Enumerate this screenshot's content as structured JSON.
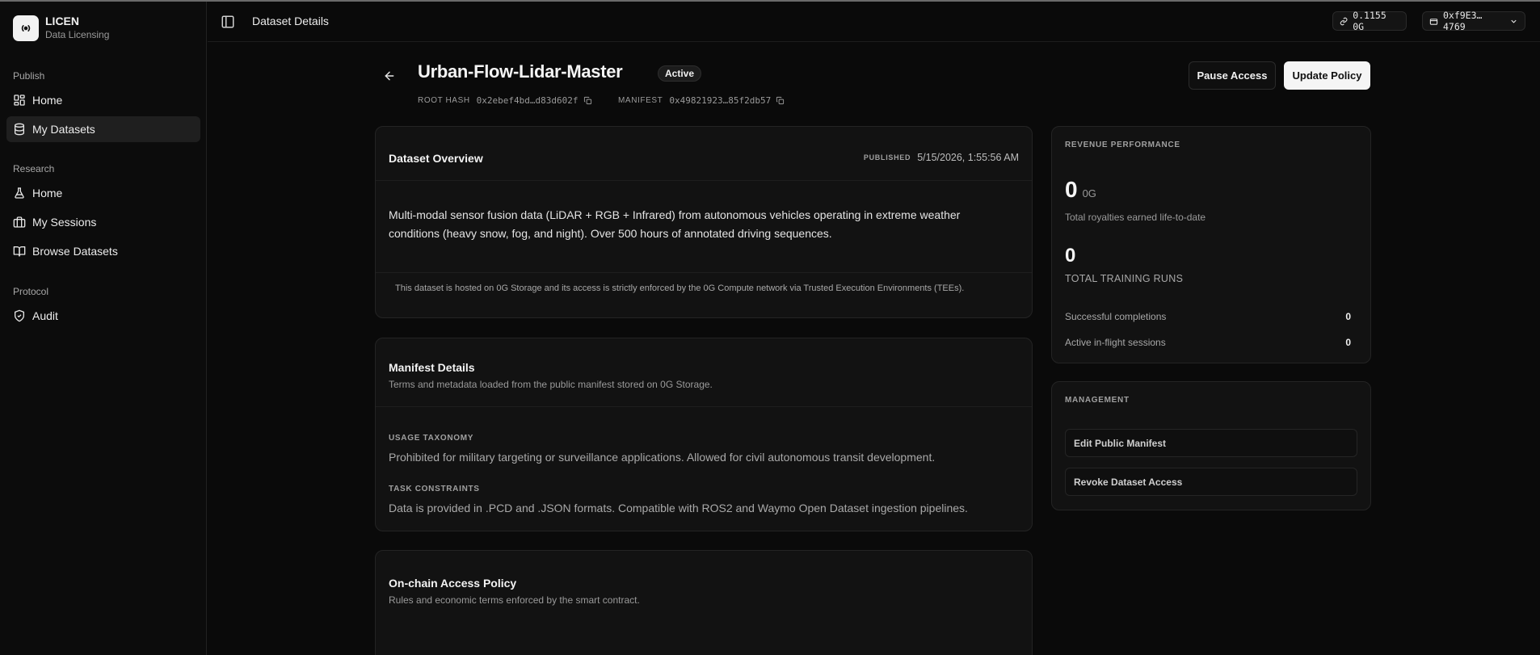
{
  "brand": {
    "name": "LICEN",
    "subtitle": "Data Licensing"
  },
  "sidebar": {
    "groups": [
      {
        "label": "Publish",
        "items": [
          {
            "label": "Home",
            "icon": "grid-icon"
          },
          {
            "label": "My Datasets",
            "icon": "database-icon",
            "active": true
          }
        ]
      },
      {
        "label": "Research",
        "items": [
          {
            "label": "Home",
            "icon": "flask-icon"
          },
          {
            "label": "My Sessions",
            "icon": "briefcase-icon"
          },
          {
            "label": "Browse Datasets",
            "icon": "book-open-icon"
          }
        ]
      },
      {
        "label": "Protocol",
        "items": [
          {
            "label": "Audit",
            "icon": "shield-check-icon"
          }
        ]
      }
    ]
  },
  "header": {
    "title": "Dataset Details",
    "balance": "0.1155 0G",
    "wallet": "0xf9E3…4769"
  },
  "dataset": {
    "name": "Urban-Flow-Lidar-Master",
    "status": "Active",
    "root_hash_label": "ROOT HASH",
    "root_hash": "0x2ebef4bd…d83d602f",
    "manifest_label": "MANIFEST",
    "manifest": "0x49821923…85f2db57"
  },
  "actions": {
    "pause": "Pause Access",
    "update": "Update Policy"
  },
  "overview": {
    "title": "Dataset Overview",
    "published_label": "PUBLISHED",
    "published_at": "5/15/2026, 1:55:56 AM",
    "description": "Multi-modal sensor fusion data (LiDAR + RGB + Infrared) from autonomous vehicles operating in extreme weather conditions (heavy snow, fog, and night). Over 500 hours of annotated driving sequences.",
    "footnote": "This dataset is hosted on 0G Storage and its access is strictly enforced by the 0G Compute network via Trusted Execution Environments (TEEs)."
  },
  "manifest_details": {
    "title": "Manifest Details",
    "subtitle": "Terms and metadata loaded from the public manifest stored on 0G Storage.",
    "usage_label": "USAGE TAXONOMY",
    "usage": "Prohibited for military targeting or surveillance applications. Allowed for civil autonomous transit development.",
    "constraints_label": "TASK CONSTRAINTS",
    "constraints": "Data is provided in .PCD and .JSON formats. Compatible with ROS2 and Waymo Open Dataset ingestion pipelines."
  },
  "policy": {
    "title": "On-chain Access Policy",
    "subtitle": "Rules and economic terms enforced by the smart contract."
  },
  "revenue": {
    "title": "REVENUE PERFORMANCE",
    "royalties_value": "0",
    "royalties_unit": "0G",
    "royalties_label": "Total royalties earned life-to-date",
    "runs_value": "0",
    "runs_label": "TOTAL TRAINING RUNS",
    "successful_label": "Successful completions",
    "successful_value": "0",
    "active_label": "Active in-flight sessions",
    "active_value": "0"
  },
  "management": {
    "title": "MANAGEMENT",
    "edit": "Edit Public Manifest",
    "revoke": "Revoke Dataset Access"
  },
  "colors": {
    "background": "#0a0a0a",
    "card": "#121212",
    "border": "#242424",
    "accent": "#f5f5f5"
  }
}
